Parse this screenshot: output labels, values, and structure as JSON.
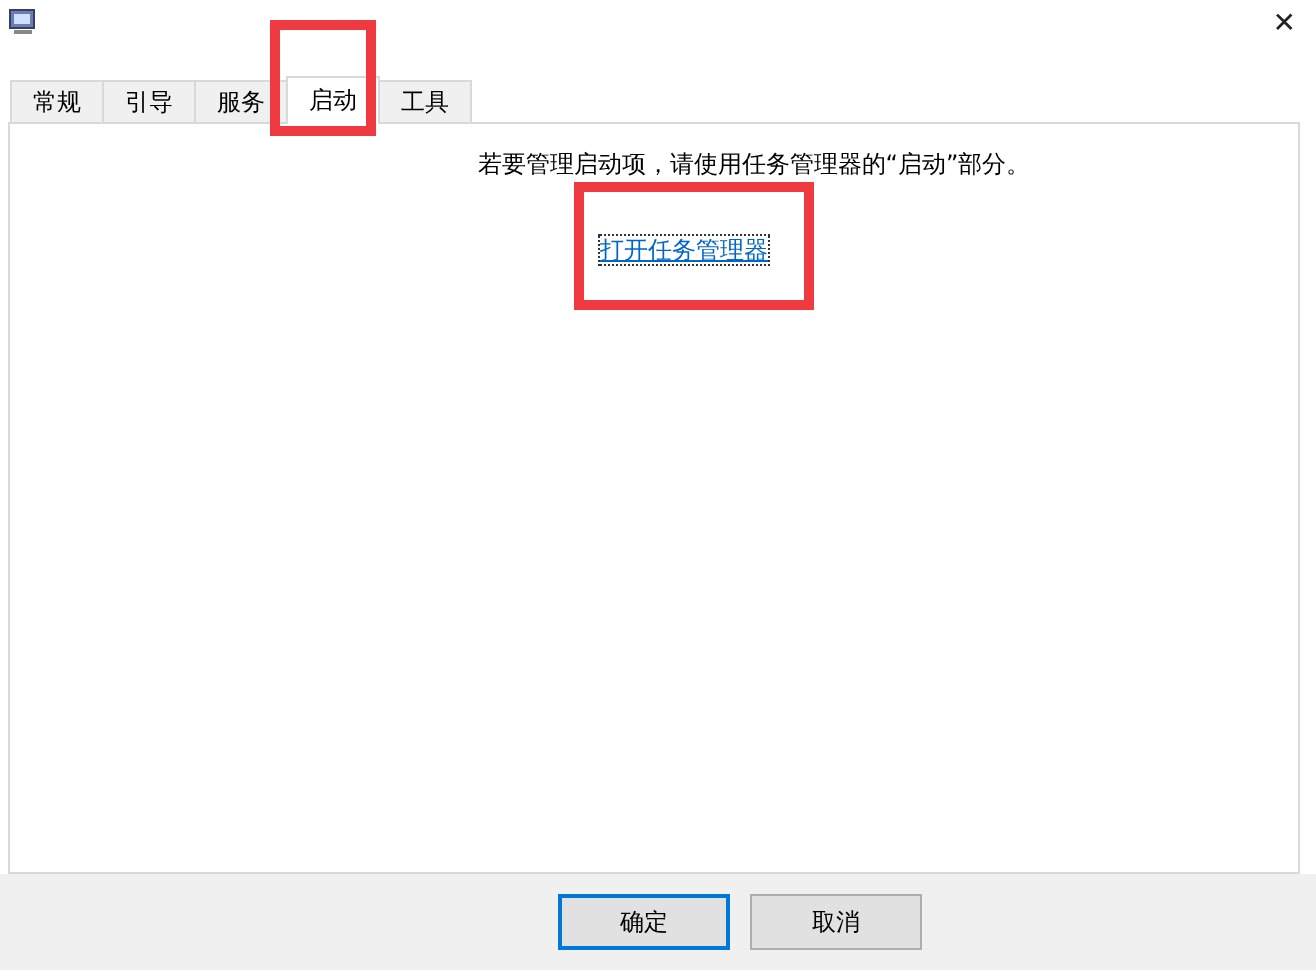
{
  "window": {
    "close": "✕"
  },
  "tabs": [
    {
      "label": "常规",
      "selected": false,
      "highlighted": false
    },
    {
      "label": "引导",
      "selected": false,
      "highlighted": false
    },
    {
      "label": "服务",
      "selected": false,
      "highlighted": false
    },
    {
      "label": "启动",
      "selected": true,
      "highlighted": true
    },
    {
      "label": "工具",
      "selected": false,
      "highlighted": false
    }
  ],
  "panel": {
    "message": "若要管理启动项，请使用任务管理器的“启动”部分。",
    "link": {
      "label": "打开任务管理器",
      "highlighted": true
    }
  },
  "buttons": [
    {
      "label": "确定",
      "default": true
    },
    {
      "label": "取消",
      "default": false
    }
  ]
}
